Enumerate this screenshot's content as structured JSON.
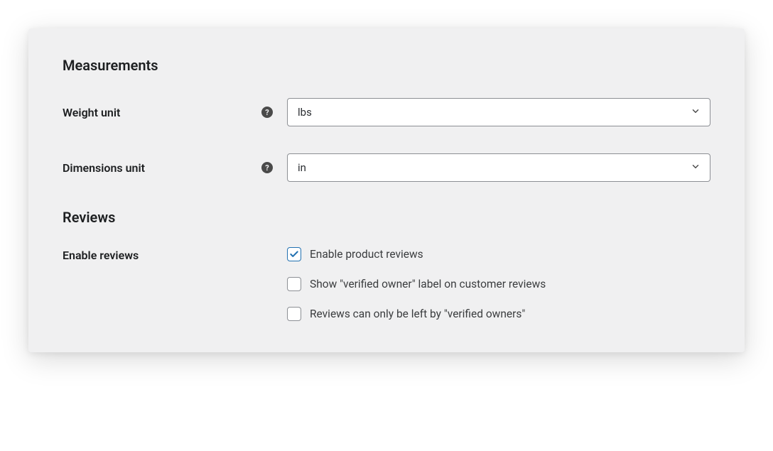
{
  "sections": {
    "measurements": {
      "heading": "Measurements",
      "weight_unit": {
        "label": "Weight unit",
        "value": "lbs"
      },
      "dimensions_unit": {
        "label": "Dimensions unit",
        "value": "in"
      }
    },
    "reviews": {
      "heading": "Reviews",
      "enable_reviews": {
        "label": "Enable reviews",
        "options": [
          {
            "label": "Enable product reviews",
            "checked": true
          },
          {
            "label": "Show \"verified owner\" label on customer reviews",
            "checked": false
          },
          {
            "label": "Reviews can only be left by \"verified owners\"",
            "checked": false
          }
        ]
      }
    }
  },
  "help_glyph": "?"
}
